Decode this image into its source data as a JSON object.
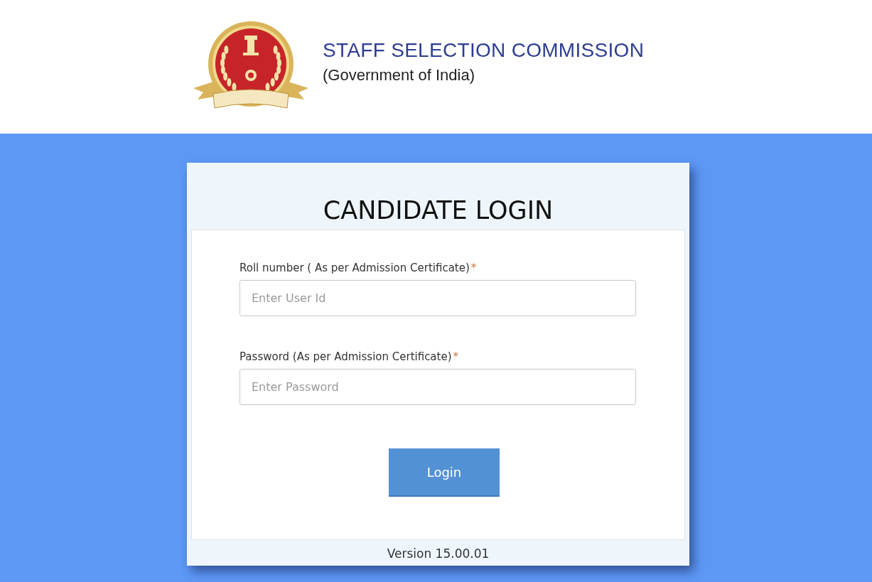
{
  "header": {
    "title": "STAFF SELECTION COMMISSION",
    "subtitle": "(Government of India)"
  },
  "login": {
    "heading": "CANDIDATE LOGIN",
    "fields": [
      {
        "label": "Roll number ( As per Admission Certificate)",
        "required_mark": "*",
        "placeholder": "Enter User Id"
      },
      {
        "label": "Password (As per Admission Certificate)",
        "required_mark": "*",
        "placeholder": "Enter Password"
      }
    ],
    "button": "Login",
    "version": "Version 15.00.01"
  }
}
